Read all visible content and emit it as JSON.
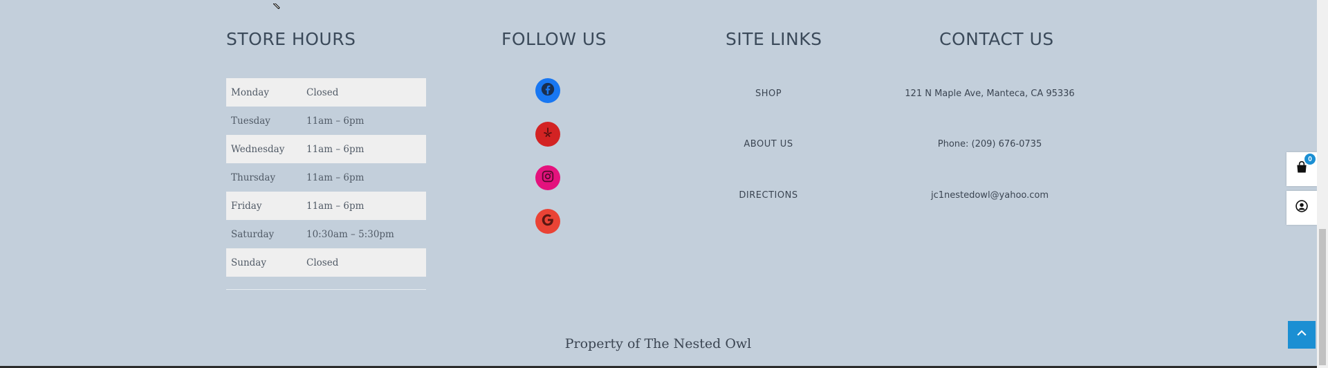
{
  "store_hours": {
    "title": "STORE HOURS",
    "rows": [
      {
        "day": "Monday",
        "hours": "Closed"
      },
      {
        "day": "Tuesday",
        "hours": "11am – 6pm"
      },
      {
        "day": "Wednesday",
        "hours": "11am – 6pm"
      },
      {
        "day": "Thursday",
        "hours": "11am – 6pm"
      },
      {
        "day": "Friday",
        "hours": "11am – 6pm"
      },
      {
        "day": "Saturday",
        "hours": "10:30am – 5:30pm"
      },
      {
        "day": "Sunday",
        "hours": "Closed"
      }
    ]
  },
  "follow_us": {
    "title": "FOLLOW US",
    "icons": [
      "facebook-icon",
      "yelp-icon",
      "instagram-icon",
      "google-icon"
    ],
    "colors": {
      "facebook": "#1877f2",
      "yelp": "#d32323",
      "instagram": "#e4127d",
      "google": "#ea4335"
    }
  },
  "site_links": {
    "title": "SITE LINKS",
    "shop": "SHOP",
    "about": "ABOUT US",
    "directions": "DIRECTIONS"
  },
  "contact": {
    "title": "CONTACT US",
    "address": "121 N Maple Ave, Manteca, CA 95336",
    "phone": "Phone: (209) 676-0735",
    "email": "jc1nestedowl@yahoo.com"
  },
  "footer": {
    "copyright": "Property of The Nested Owl"
  },
  "widgets": {
    "cart_count": "0",
    "accent_color": "#1b8fd3"
  }
}
